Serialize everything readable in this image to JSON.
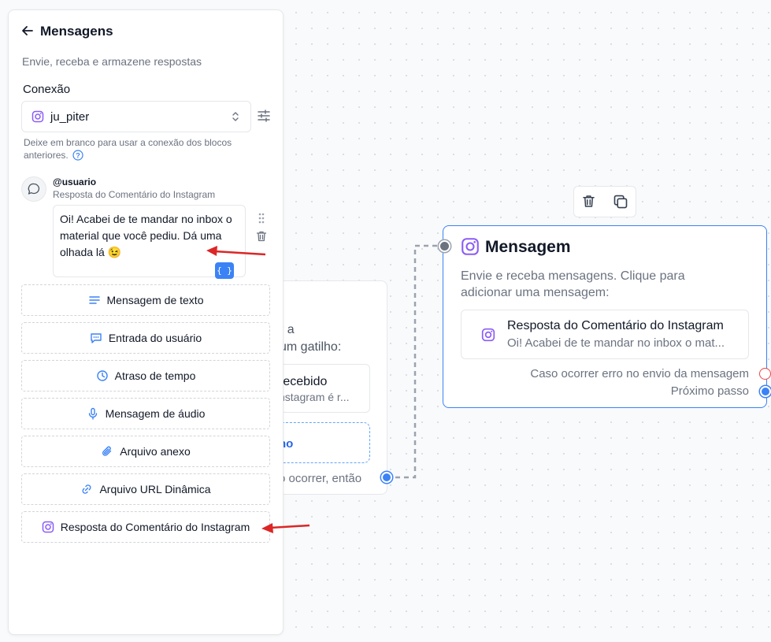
{
  "panel": {
    "title": "Mensagens",
    "subtitle": "Envie, receba e armazene respostas",
    "connection_label": "Conexão",
    "connection_value": "ju_piter",
    "connection_help": "Deixe em branco para usar a conexão dos blocos anteriores.",
    "message": {
      "user": "@usuario",
      "type": "Resposta do Comentário do Instagram",
      "text": "Oi! Acabei de te mandar no inbox o material que você pediu. Dá uma olhada lá 😉",
      "variable_button": "{ }"
    },
    "options": [
      {
        "label": "Mensagem de texto",
        "icon": "text-lines-icon"
      },
      {
        "label": "Entrada do usuário",
        "icon": "chat-input-icon"
      },
      {
        "label": "Atraso de tempo",
        "icon": "clock-icon"
      },
      {
        "label": "Mensagem de áudio",
        "icon": "microphone-icon"
      },
      {
        "label": "Arquivo anexo",
        "icon": "paperclip-icon"
      },
      {
        "label": "Arquivo URL Dinâmica",
        "icon": "link-icon"
      },
      {
        "label": "Resposta do Comentário do Instagram",
        "icon": "instagram-icon"
      }
    ]
  },
  "trigger_node": {
    "description_partial": "r a\num gatilho:",
    "item_title": "recebido",
    "item_sub": "nstagram é r...",
    "add_label": "no",
    "then_label": "o ocorrer, então"
  },
  "message_node": {
    "title": "Mensagem",
    "description": "Envie e receba mensagens. Clique para adicionar uma mensagem:",
    "item_title": "Resposta do Comentário do Instagram",
    "item_sub": "Oi! Acabei de te mandar no inbox o mat...",
    "error_label": "Caso ocorrer erro no envio da mensagem",
    "next_label": "Próximo passo"
  },
  "colors": {
    "accent": "#3b82f6",
    "instagram": "#8b5cf6",
    "annotation_arrow": "#dc2626",
    "error": "#ef4444"
  }
}
